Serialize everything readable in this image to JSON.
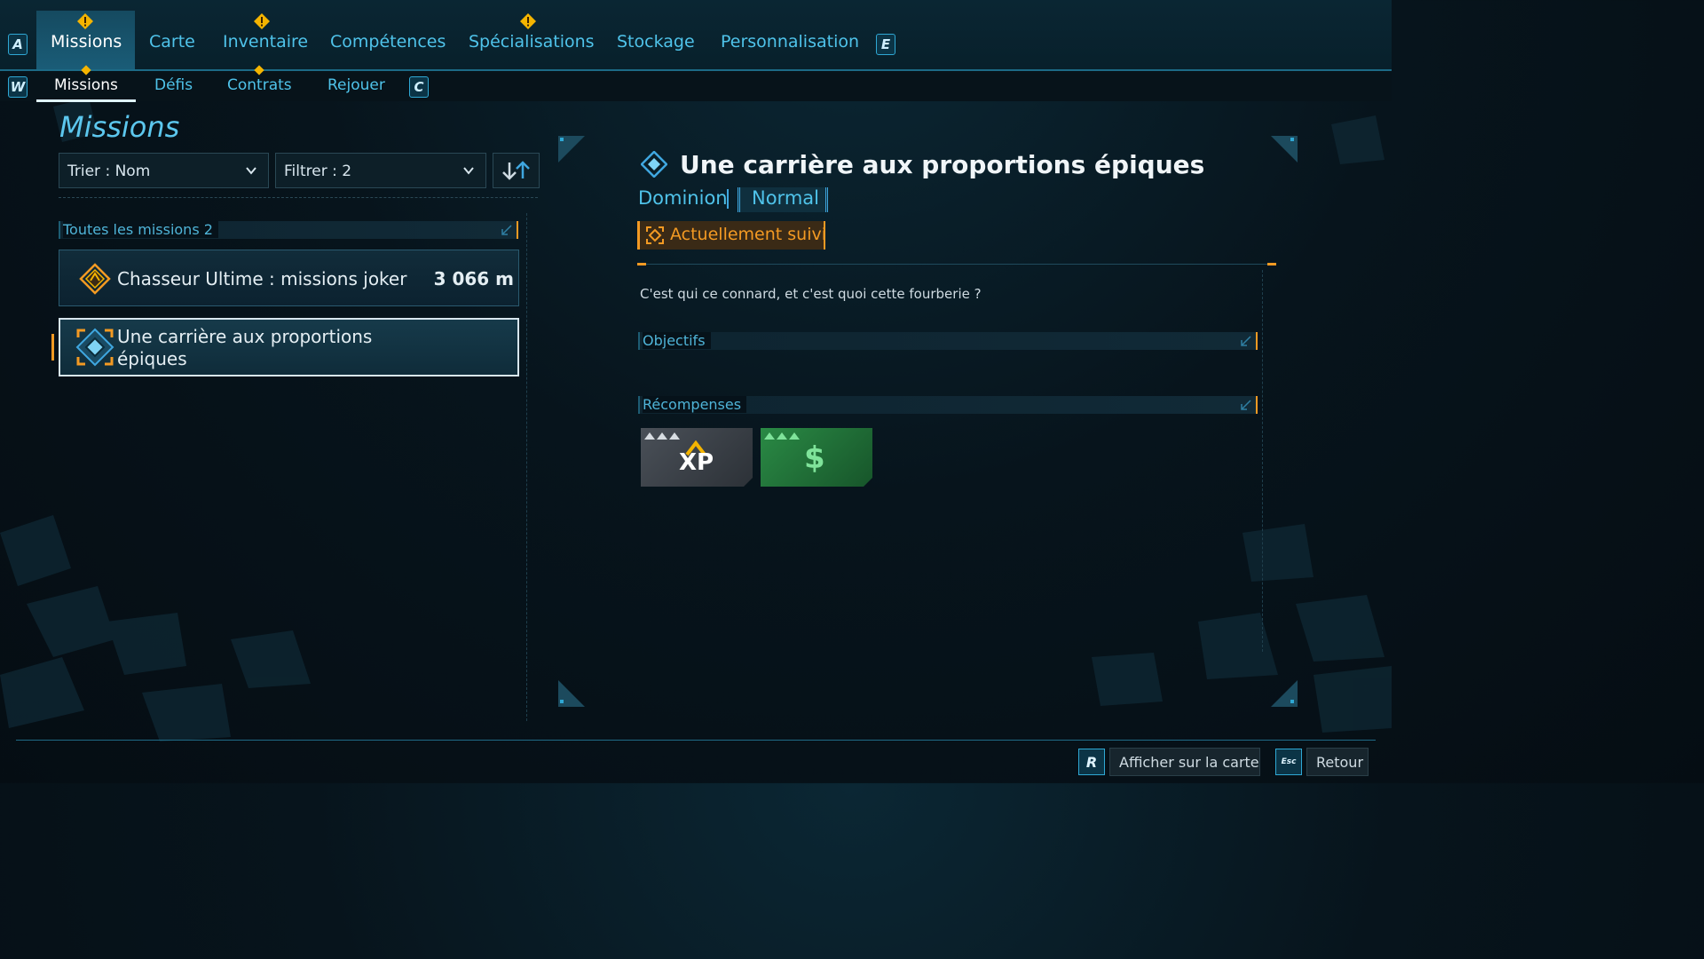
{
  "nav": {
    "left_key": "A",
    "right_key": "E",
    "tabs": [
      {
        "label": "Missions",
        "active": true,
        "alert": true
      },
      {
        "label": "Carte",
        "active": false,
        "alert": false
      },
      {
        "label": "Inventaire",
        "active": false,
        "alert": true
      },
      {
        "label": "Compétences",
        "active": false,
        "alert": false
      },
      {
        "label": "Spécialisations",
        "active": false,
        "alert": true
      },
      {
        "label": "Stockage",
        "active": false,
        "alert": false
      },
      {
        "label": "Personnalisation",
        "active": false,
        "alert": false
      }
    ]
  },
  "subnav": {
    "left_key": "W",
    "right_key": "C",
    "tabs": [
      {
        "label": "Missions",
        "active": true
      },
      {
        "label": "Défis",
        "active": false
      },
      {
        "label": "Contrats",
        "active": false
      },
      {
        "label": "Rejouer",
        "active": false
      }
    ]
  },
  "page_title": "Missions",
  "controls": {
    "sort_label": "Trier : Nom",
    "filter_label": "Filtrer : 2"
  },
  "list": {
    "section_label": "Toutes les missions 2",
    "missions": [
      {
        "title": "Chasseur Ultime : missions joker",
        "distance": "3 066 m",
        "selected": false
      },
      {
        "title": "Une carrière aux proportions épiques",
        "distance": "",
        "selected": true
      }
    ]
  },
  "detail": {
    "title": "Une carrière aux proportions épiques",
    "faction": "Dominion",
    "difficulty": "Normal",
    "tracked_label": "Actuellement suivi",
    "description": "C'est qui ce connard, et c'est quoi cette fourberie ?",
    "objectives_label": "Objectifs",
    "rewards_label": "Récompenses",
    "rewards": [
      {
        "type": "xp",
        "label": "XP",
        "color": "#3a3f45"
      },
      {
        "type": "money",
        "label": "$",
        "color": "#1f6b34"
      }
    ]
  },
  "footer": {
    "map_key": "R",
    "map_label": "Afficher sur la carte",
    "back_key": "Esc",
    "back_label": "Retour"
  },
  "colors": {
    "accent_blue": "#4fc3ea",
    "accent_orange": "#f39a23",
    "alert_yellow": "#f4b400"
  }
}
